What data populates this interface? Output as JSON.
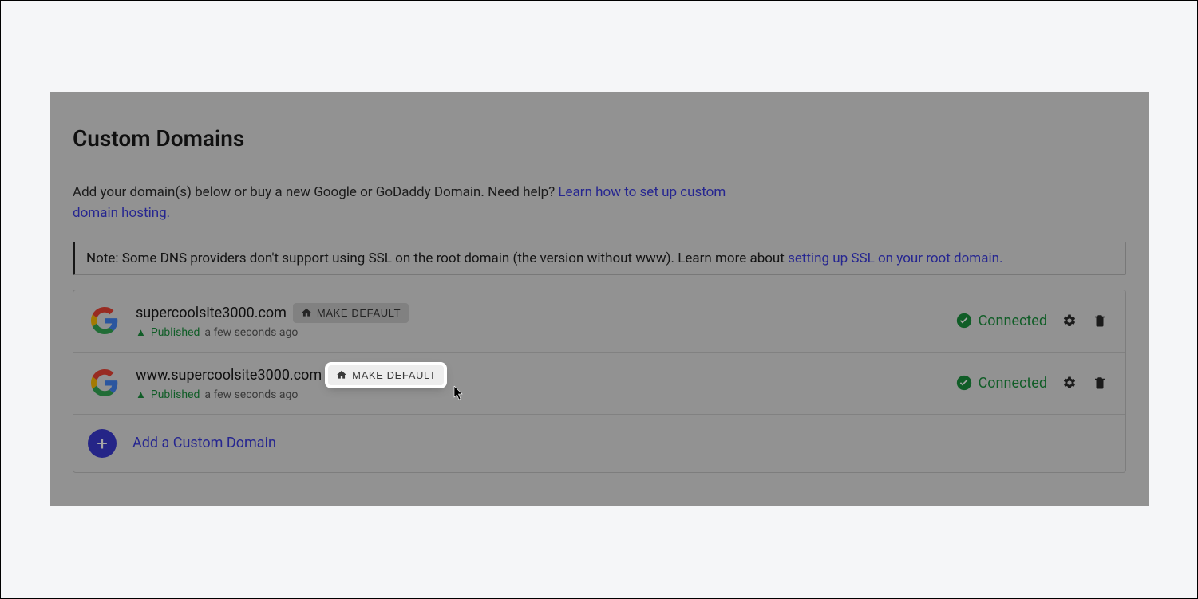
{
  "title": "Custom Domains",
  "intro_text": "Add your domain(s) below or buy a new Google or GoDaddy Domain. Need help? ",
  "intro_link": "Learn how to set up custom domain hosting.",
  "note_text": "Note: Some DNS providers don't support using SSL on the root domain (the version without www). Learn more about ",
  "note_link": "setting up SSL on your root domain.",
  "domains": [
    {
      "name": "supercoolsite3000.com",
      "make_default_label": "MAKE DEFAULT",
      "published_label": "Published",
      "time_ago": "a few seconds ago",
      "connected_label": "Connected"
    },
    {
      "name": "www.supercoolsite3000.com",
      "make_default_label": "MAKE DEFAULT",
      "published_label": "Published",
      "time_ago": "a few seconds ago",
      "connected_label": "Connected"
    }
  ],
  "add_domain_label": "Add a Custom Domain"
}
